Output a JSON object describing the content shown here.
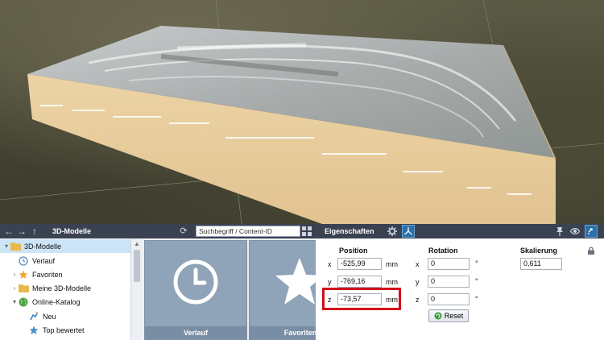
{
  "scene": {
    "description_hidden": true
  },
  "left_panel": {
    "title": "3D-Modelle",
    "nav": {
      "back": "←",
      "forward": "→",
      "up": "↑",
      "refresh": "⟳"
    },
    "search_placeholder": "Suchbegriff / Content-ID",
    "tree": [
      {
        "label": "3D-Modelle",
        "level": 0,
        "expanded": true,
        "selected": true,
        "icon": "folder-icon"
      },
      {
        "label": "Verlauf",
        "level": 1,
        "icon": "history-icon"
      },
      {
        "label": "Favoriten",
        "level": 1,
        "collapsed": true,
        "icon": "star-icon"
      },
      {
        "label": "Meine 3D-Modelle",
        "level": 1,
        "collapsed": true,
        "icon": "folder-icon"
      },
      {
        "label": "Online-Katalog",
        "level": 1,
        "expanded": true,
        "icon": "globe-icon"
      },
      {
        "label": "Neu",
        "level": 2,
        "icon": "new-icon"
      },
      {
        "label": "Top bewertet",
        "level": 2,
        "icon": "top-rated-icon"
      }
    ],
    "tiles": [
      {
        "label": "Verlauf",
        "icon": "clock-icon"
      },
      {
        "label": "Favoriten",
        "icon": "star-icon"
      }
    ]
  },
  "right_panel": {
    "title": "Eigenschaften",
    "position": {
      "header": "Position",
      "x": {
        "axis": "x",
        "value": "-525,99",
        "unit": "mm"
      },
      "y": {
        "axis": "y",
        "value": "-769,16",
        "unit": "mm"
      },
      "z": {
        "axis": "z",
        "value": "-73,57",
        "unit": "mm"
      }
    },
    "rotation": {
      "header": "Rotation",
      "x": {
        "axis": "x",
        "value": "0",
        "unit": "°"
      },
      "y": {
        "axis": "y",
        "value": "0",
        "unit": "°"
      },
      "z": {
        "axis": "z",
        "value": "0",
        "unit": "°"
      }
    },
    "scale": {
      "header": "Skalierung",
      "value": "0,611"
    },
    "reset_label": "Reset"
  },
  "colors": {
    "toolbar": "#3a4252",
    "accent": "#2d6fa8",
    "highlight": "#d0101a",
    "tile": "#8fa3b9"
  }
}
